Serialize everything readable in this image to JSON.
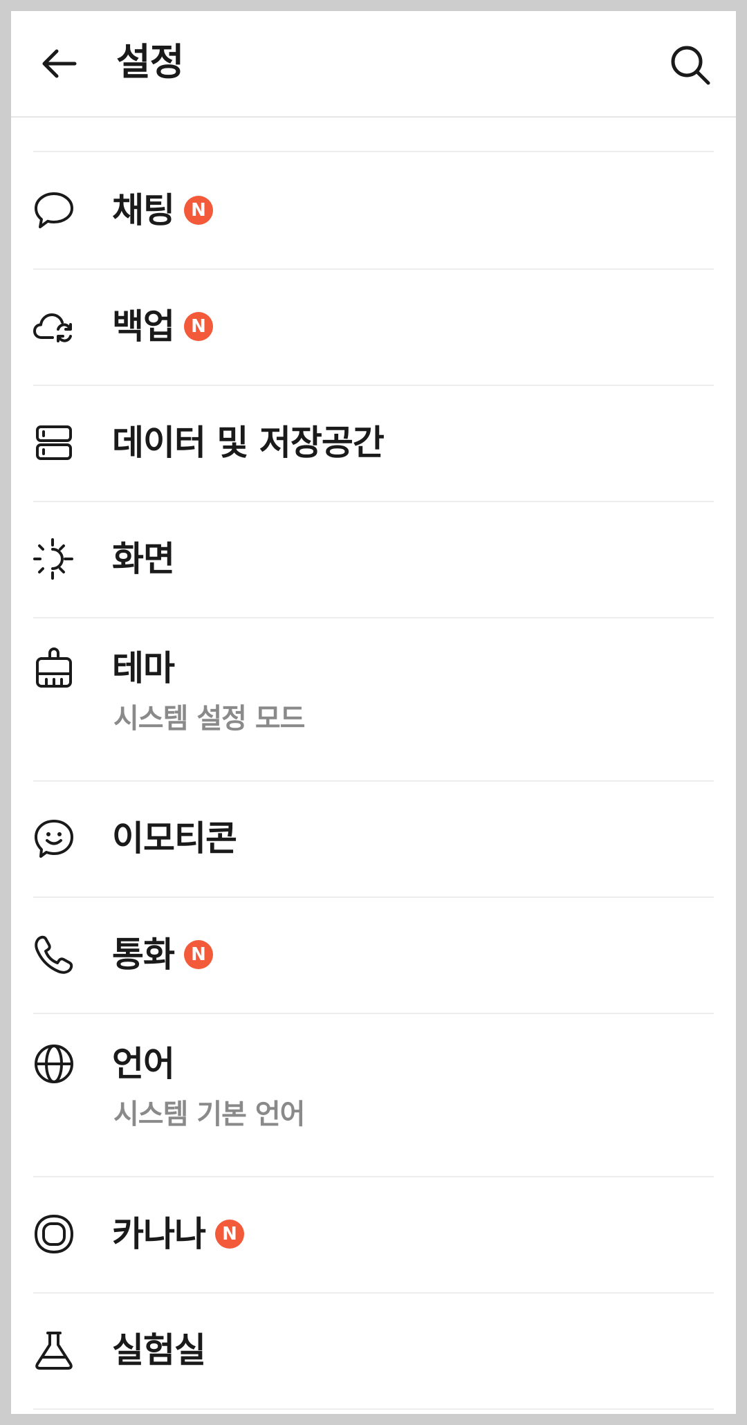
{
  "header": {
    "title": "설정",
    "back_icon": "arrow-left-icon",
    "search_icon": "search-icon"
  },
  "badge_text": "N",
  "colors": {
    "badge": "#f25a3a",
    "subtext": "#8a8a8a",
    "divider": "#ededed"
  },
  "items": [
    {
      "label": "채팅",
      "icon": "chat-bubble-icon",
      "badge": true
    },
    {
      "label": "백업",
      "icon": "cloud-sync-icon",
      "badge": true
    },
    {
      "label": "데이터 및 저장공간",
      "icon": "storage-icon",
      "badge": false
    },
    {
      "label": "화면",
      "icon": "brightness-icon",
      "badge": false
    },
    {
      "label": "테마",
      "icon": "paint-brush-icon",
      "badge": false,
      "sub": "시스템 설정 모드"
    },
    {
      "label": "이모티콘",
      "icon": "emoticon-icon",
      "badge": false
    },
    {
      "label": "통화",
      "icon": "phone-icon",
      "badge": true
    },
    {
      "label": "언어",
      "icon": "globe-icon",
      "badge": false,
      "sub": "시스템 기본 언어"
    },
    {
      "label": "카나나",
      "icon": "kanana-icon",
      "badge": true
    },
    {
      "label": "실험실",
      "icon": "flask-icon",
      "badge": false
    }
  ]
}
